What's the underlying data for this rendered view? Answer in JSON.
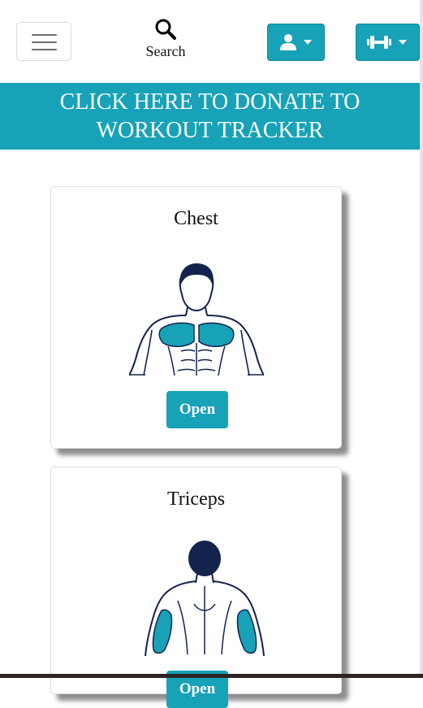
{
  "header": {
    "menu_icon": "hamburger-icon",
    "search_label": "Search",
    "search_icon": "search-icon",
    "user_menu_icon": "user-icon",
    "workout_menu_icon": "dumbbell-icon"
  },
  "banner": {
    "line1": "CLICK HERE TO DONATE TO",
    "line2": "WORKOUT TRACKER"
  },
  "cards": [
    {
      "title": "Chest",
      "button_label": "Open",
      "figure_icon": "chest-muscle-figure"
    },
    {
      "title": "Triceps",
      "button_label": "Open",
      "figure_icon": "triceps-muscle-figure"
    }
  ],
  "colors": {
    "accent": "#17a2b8",
    "figure_outline": "#14234d",
    "card_border": "#dedede"
  }
}
